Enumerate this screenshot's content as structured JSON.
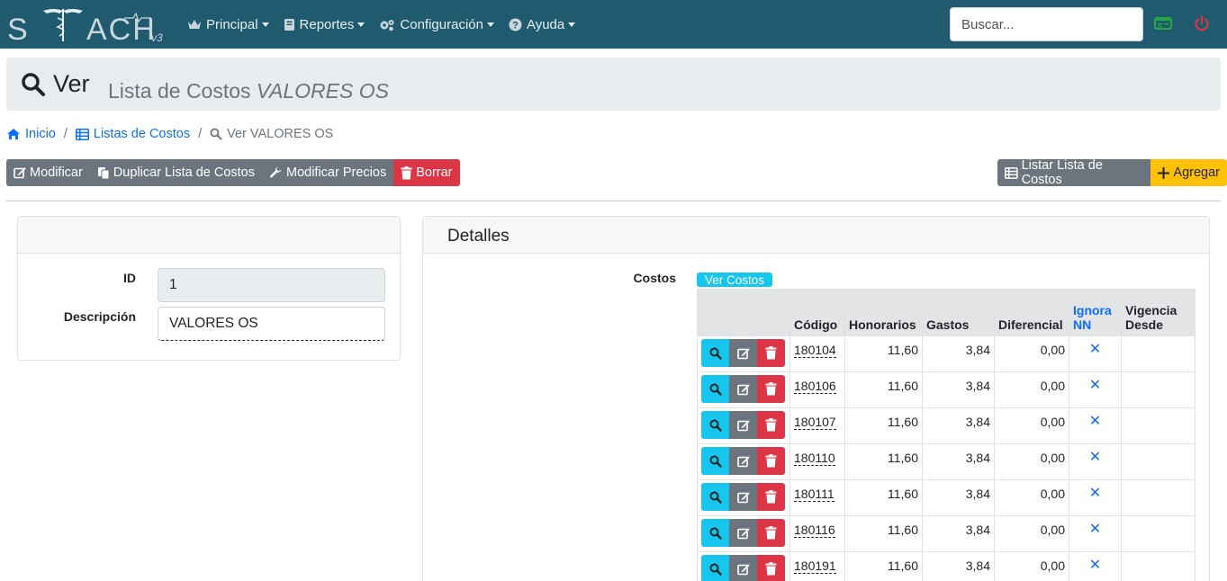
{
  "navbar": {
    "brand_letters": [
      "S",
      "ACH"
    ],
    "brand_version": "v3",
    "menu": [
      {
        "label": "Principal",
        "icon": "crown-icon"
      },
      {
        "label": "Reportes",
        "icon": "book-icon"
      },
      {
        "label": "Configuración",
        "icon": "gears-icon"
      },
      {
        "label": "Ayuda",
        "icon": "question-circle-icon"
      }
    ],
    "search_placeholder": "Buscar...",
    "colors": {
      "bar": "#1f5a6e",
      "card_icon": "#28a745",
      "power_icon": "#dc3545"
    }
  },
  "header": {
    "title": "Ver",
    "subtitle": "Lista de Costos",
    "subtitle_italic": "VALORES OS"
  },
  "breadcrumb": {
    "home": "Inicio",
    "list": "Listas de Costos",
    "current": "Ver VALORES OS"
  },
  "toolbar": {
    "modificar": "Modificar",
    "duplicar": "Duplicar Lista de Costos",
    "modificar_precios": "Modificar Precios",
    "borrar": "Borrar",
    "listar": "Listar Lista de Costos",
    "agregar": "Agregar"
  },
  "left_card": {
    "id_label": "ID",
    "id_value": "1",
    "descripcion_label": "Descripción",
    "descripcion_value": "VALORES OS"
  },
  "detalles": {
    "title": "Detalles",
    "costos_label": "Costos",
    "ver_costos": "Ver Costos",
    "columns": {
      "codigo": "Código",
      "honorarios": "Honorarios",
      "gastos": "Gastos",
      "diferencial": "Diferencial",
      "ignora_line1": "Ignora",
      "ignora_line2": "NN",
      "vigencia_line1": "Vigencia",
      "vigencia_line2": "Desde"
    },
    "rows": [
      {
        "codigo": "180104",
        "honorarios": "11,60",
        "gastos": "3,84",
        "diferencial": "0,00",
        "ignora": "✕",
        "vigencia": ""
      },
      {
        "codigo": "180106",
        "honorarios": "11,60",
        "gastos": "3,84",
        "diferencial": "0,00",
        "ignora": "✕",
        "vigencia": ""
      },
      {
        "codigo": "180107",
        "honorarios": "11,60",
        "gastos": "3,84",
        "diferencial": "0,00",
        "ignora": "✕",
        "vigencia": ""
      },
      {
        "codigo": "180110",
        "honorarios": "11,60",
        "gastos": "3,84",
        "diferencial": "0,00",
        "ignora": "✕",
        "vigencia": ""
      },
      {
        "codigo": "180111",
        "honorarios": "11,60",
        "gastos": "3,84",
        "diferencial": "0,00",
        "ignora": "✕",
        "vigencia": ""
      },
      {
        "codigo": "180116",
        "honorarios": "11,60",
        "gastos": "3,84",
        "diferencial": "0,00",
        "ignora": "✕",
        "vigencia": ""
      },
      {
        "codigo": "180191",
        "honorarios": "11,60",
        "gastos": "3,84",
        "diferencial": "0,00",
        "ignora": "✕",
        "vigencia": ""
      }
    ]
  }
}
